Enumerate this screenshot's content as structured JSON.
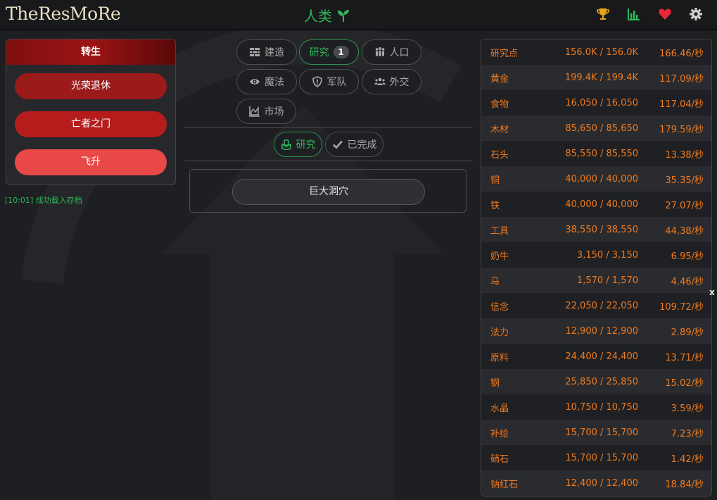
{
  "header": {
    "logo": "TheResMoRe",
    "race": "人类",
    "icons": [
      "trophy-icon",
      "stats-icon",
      "heart-icon",
      "gear-icon"
    ],
    "colors": {
      "race": "#2fb85a",
      "trophy": "#e8a317",
      "stats": "#2fb85a",
      "heart": "#e8283a",
      "gear": "#cfcfcf"
    }
  },
  "prestige": {
    "title": "转生",
    "buttons": [
      "光荣退休",
      "亡者之门",
      "飞升"
    ],
    "button_colors": [
      "#9b1b1b",
      "#b51d1d",
      "#e84848"
    ]
  },
  "log": {
    "message": "[10:01] 成功载入存档"
  },
  "tabs": [
    {
      "label": "建造",
      "icon": "wall-icon"
    },
    {
      "label": "研究",
      "icon": "",
      "badge": "1",
      "active": true
    },
    {
      "label": "人口",
      "icon": "people-icon"
    },
    {
      "label": "魔法",
      "icon": "eye-icon"
    },
    {
      "label": "军队",
      "icon": "shield-icon"
    },
    {
      "label": "外交",
      "icon": "users-icon"
    },
    {
      "label": "市场",
      "icon": "chart-area-icon"
    }
  ],
  "subtabs": [
    {
      "label": "研究",
      "icon": "book-icon",
      "active": true
    },
    {
      "label": "已完成",
      "icon": "check-icon"
    }
  ],
  "research": {
    "item": "巨大洞穴"
  },
  "resources": [
    {
      "name": "研究点",
      "amount": "156.0K / 156.0K",
      "rate": "166.46/秒"
    },
    {
      "name": "黄金",
      "amount": "199.4K / 199.4K",
      "rate": "117.09/秒"
    },
    {
      "name": "食物",
      "amount": "16,050 / 16,050",
      "rate": "117.04/秒"
    },
    {
      "name": "木材",
      "amount": "85,650 / 85,650",
      "rate": "179.59/秒"
    },
    {
      "name": "石头",
      "amount": "85,550 / 85,550",
      "rate": "13.38/秒"
    },
    {
      "name": "铜",
      "amount": "40,000 / 40,000",
      "rate": "35.35/秒"
    },
    {
      "name": "铁",
      "amount": "40,000 / 40,000",
      "rate": "27.07/秒"
    },
    {
      "name": "工具",
      "amount": "38,550 / 38,550",
      "rate": "44.38/秒"
    },
    {
      "name": "奶牛",
      "amount": "3,150 / 3,150",
      "rate": "6.95/秒"
    },
    {
      "name": "马",
      "amount": "1,570 / 1,570",
      "rate": "4.46/秒"
    },
    {
      "name": "信念",
      "amount": "22,050 / 22,050",
      "rate": "109.72/秒"
    },
    {
      "name": "法力",
      "amount": "12,900 / 12,900",
      "rate": "2.89/秒"
    },
    {
      "name": "原料",
      "amount": "24,400 / 24,400",
      "rate": "13.71/秒"
    },
    {
      "name": "钢",
      "amount": "25,850 / 25,850",
      "rate": "15.02/秒"
    },
    {
      "name": "水晶",
      "amount": "10,750 / 10,750",
      "rate": "3.59/秒"
    },
    {
      "name": "补给",
      "amount": "15,700 / 15,700",
      "rate": "7.23/秒"
    },
    {
      "name": "硝石",
      "amount": "15,700 / 15,700",
      "rate": "1.42/秒"
    },
    {
      "name": "钠红石",
      "amount": "12,400 / 12,400",
      "rate": "18.84/秒"
    }
  ],
  "close_label": "x"
}
